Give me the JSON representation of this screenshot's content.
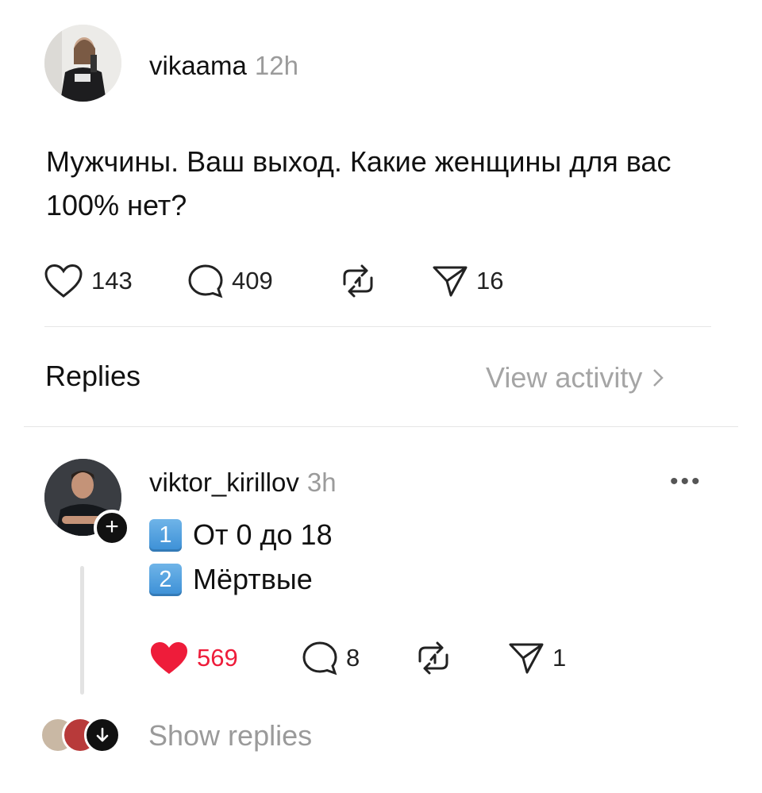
{
  "post": {
    "username": "vikaama",
    "time": "12h",
    "text": "Мужчины. Ваш выход. Какие женщины для вас 100% нет?",
    "likes": "143",
    "comments": "409",
    "shares": "16"
  },
  "replies_header": {
    "title": "Replies",
    "view_activity": "View activity"
  },
  "reply": {
    "username": "viktor_kirillov",
    "time": "3h",
    "lines": [
      {
        "key": "1",
        "text": "От 0 до 18"
      },
      {
        "key": "2",
        "text": "Мёртвые"
      }
    ],
    "likes": "569",
    "comments": "8",
    "shares": "1",
    "liked": true,
    "more": "•••"
  },
  "show_replies": "Show replies",
  "colors": {
    "like_red": "#ee1c3a",
    "muted": "#9b9b9b",
    "divider": "#e6e6e6"
  }
}
